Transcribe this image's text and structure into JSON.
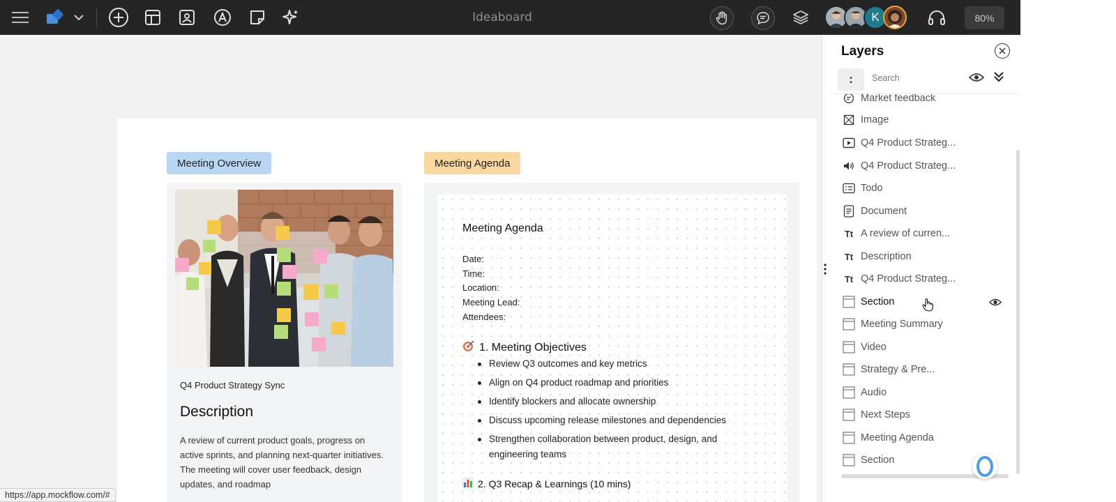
{
  "topbar": {
    "title": "Ideaboard",
    "zoom": "80%",
    "avatar_initial": "K",
    "icons": [
      "menu-icon",
      "app-logo-icon",
      "chevron-down-icon",
      "add-icon",
      "template-icon",
      "image-icon",
      "text-shape-icon",
      "sticky-note-icon",
      "ai-sparkle-icon",
      "hand-icon",
      "comment-icon",
      "layers-icon",
      "headphones-icon"
    ],
    "colors": {
      "bar": "#252525",
      "avatar_k": "#1f7a8c"
    }
  },
  "board": {
    "overview_tag": "Meeting Overview",
    "agenda_tag": "Meeting Agenda",
    "overview": {
      "subtitle": "Q4 Product Strategy Sync",
      "heading": "Description",
      "text": "A review of current product goals, progress on active sprints, and planning next-quarter initiatives. The meeting will cover user feedback, design updates, and roadmap"
    },
    "agenda": {
      "title": "Meeting Agenda",
      "fields": [
        "Date:",
        "Time:",
        "Location:",
        "Meeting Lead:",
        "Attendees:"
      ],
      "objectives_heading": "1. Meeting Objectives",
      "objectives": [
        "Review Q3 outcomes and key metrics",
        "Align on Q4 product roadmap and priorities",
        "Identify blockers and allocate ownership",
        "Discuss upcoming release milestones and dependencies",
        "Strengthen collaboration between product, design, and engineering teams"
      ],
      "recap_heading": "2. Q3 Recap & Learnings (10 mins)"
    },
    "colors": {
      "overview_tag": "#b9d6f3",
      "agenda_tag": "#fad7a0"
    }
  },
  "status_url": "https://app.mockflow.com/#",
  "layers_panel": {
    "title": "Layers",
    "search_placeholder": "Search",
    "items": [
      {
        "label": "Market feedback",
        "icon": "text-doc-icon"
      },
      {
        "label": "Image",
        "icon": "image-placeholder-icon"
      },
      {
        "label": "Q4 Product Strateg...",
        "icon": "video-icon"
      },
      {
        "label": "Q4 Product Strateg...",
        "icon": "audio-icon"
      },
      {
        "label": "Todo",
        "icon": "todo-icon"
      },
      {
        "label": "Document",
        "icon": "document-icon"
      },
      {
        "label": "A review of curren...",
        "icon": "text-icon"
      },
      {
        "label": "Description",
        "icon": "text-icon"
      },
      {
        "label": "Q4 Product Strateg...",
        "icon": "text-icon"
      },
      {
        "label": "Section",
        "icon": "section-icon"
      },
      {
        "label": "Meeting Summary",
        "icon": "section-icon"
      },
      {
        "label": "Video",
        "icon": "section-icon"
      },
      {
        "label": "Strategy & Pre...",
        "icon": "section-icon"
      },
      {
        "label": "Audio",
        "icon": "section-icon"
      },
      {
        "label": "Next Steps",
        "icon": "section-icon"
      },
      {
        "label": "Meeting Agenda",
        "icon": "section-icon"
      },
      {
        "label": "Section",
        "icon": "section-icon"
      }
    ],
    "text_icon_glyph": "Tt"
  }
}
